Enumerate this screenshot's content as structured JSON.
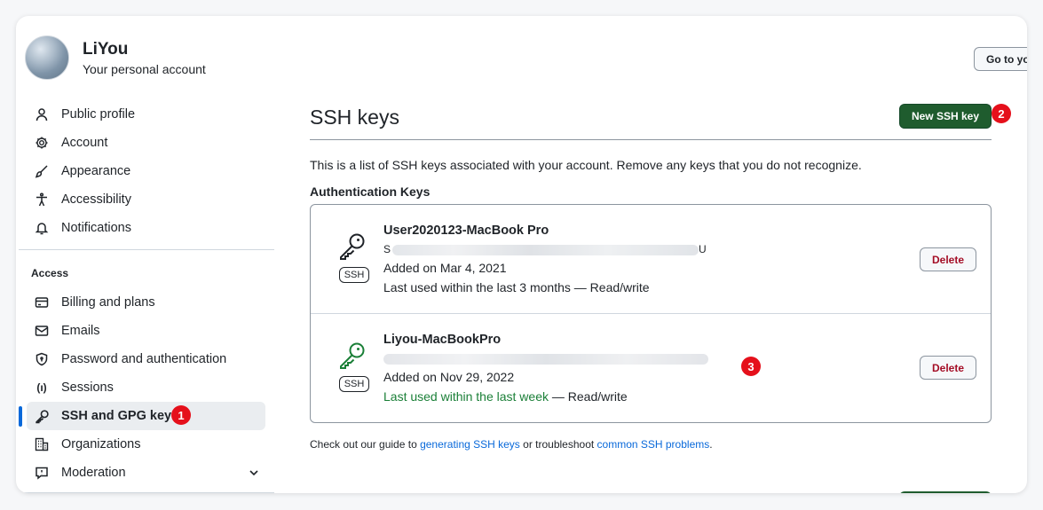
{
  "account": {
    "name": "LiYou",
    "subtitle": "Your personal account",
    "goto_label": "Go to yo"
  },
  "sidebar": {
    "items": [
      {
        "label": "Public profile",
        "icon": "person-icon"
      },
      {
        "label": "Account",
        "icon": "gear-icon"
      },
      {
        "label": "Appearance",
        "icon": "paintbrush-icon"
      },
      {
        "label": "Accessibility",
        "icon": "accessibility-icon"
      },
      {
        "label": "Notifications",
        "icon": "bell-icon"
      }
    ],
    "access_heading": "Access",
    "access_items": [
      {
        "label": "Billing and plans",
        "icon": "credit-card-icon"
      },
      {
        "label": "Emails",
        "icon": "mail-icon"
      },
      {
        "label": "Password and authentication",
        "icon": "shield-lock-icon"
      },
      {
        "label": "Sessions",
        "icon": "broadcast-icon",
        "icon_text": "(ı)"
      },
      {
        "label": "SSH and GPG keys",
        "icon": "key-icon",
        "active": true
      },
      {
        "label": "Organizations",
        "icon": "organization-icon"
      },
      {
        "label": "Moderation",
        "icon": "report-icon"
      }
    ]
  },
  "main": {
    "title": "SSH keys",
    "new_key_label": "New SSH key",
    "intro": "This is a list of SSH keys associated with your account. Remove any keys that you do not recognize.",
    "auth_heading": "Authentication Keys",
    "keys": [
      {
        "title": "User2020123-MacBook Pro",
        "fp_start": "S",
        "fp_end": "U",
        "added": "Added on Mar 4, 2021",
        "used_text": "Last used within the last 3 months — Read/write",
        "tag": "SSH",
        "delete_label": "Delete"
      },
      {
        "title": "Liyou-MacBookPro",
        "added": "Added on Nov 29, 2022",
        "used_green": "Last used within the last week",
        "used_rest": " — Read/write",
        "tag": "SSH",
        "delete_label": "Delete"
      }
    ],
    "footer": {
      "prefix": "Check out our guide to ",
      "link1": "generating SSH keys",
      "middle": " or troubleshoot ",
      "link2": "common SSH problems",
      "suffix": "."
    }
  },
  "badges": [
    "1",
    "2",
    "3"
  ],
  "colors": {
    "primary_green": "#1f5c2e",
    "link_blue": "#0969da",
    "badge_red": "#e5101b",
    "danger_red": "#a40e26",
    "active_green_text": "#1a7f37"
  }
}
